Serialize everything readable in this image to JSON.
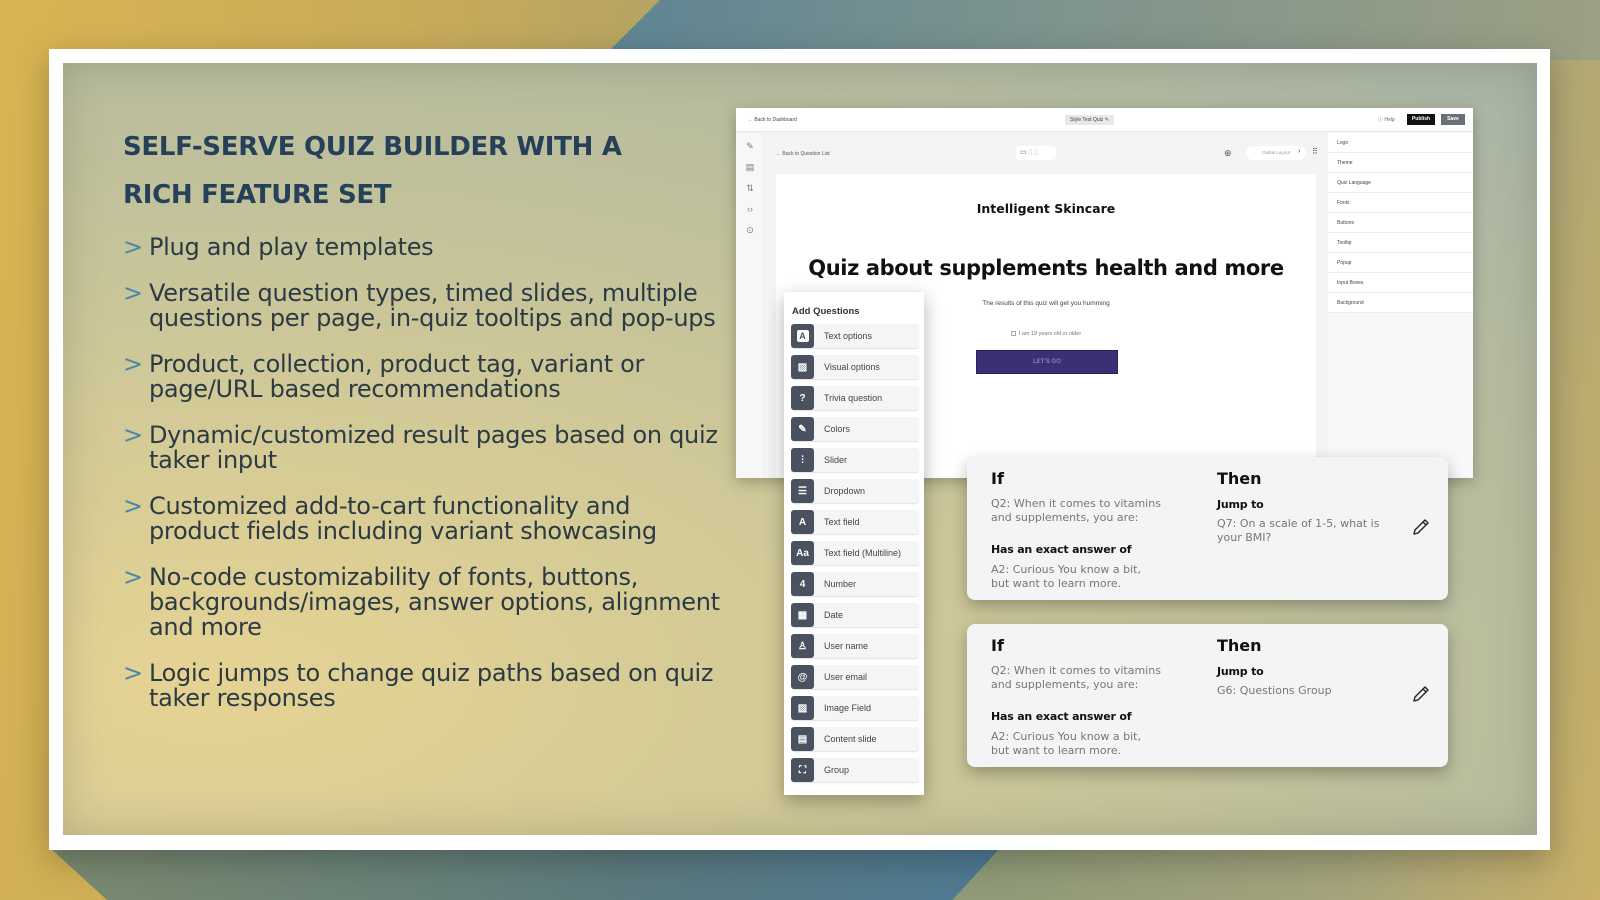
{
  "slide": {
    "headline": "SELF-SERVE QUIZ BUILDER WITH A RICH FEATURE SET",
    "bullet_icon": "chevron-right-icon",
    "features": [
      "Plug and play templates",
      "Versatile question types, timed slides, multiple questions per page, in-quiz tooltips and pop-ups",
      "Product, collection, product tag, variant or page/URL based recommendations",
      "Dynamic/customized result pages based on quiz taker input",
      "Customized add-to-cart functionality and product fields including variant showcasing",
      "No-code customizability of fonts, buttons, backgrounds/images, answer options, alignment and more",
      "Logic jumps to change quiz paths based on quiz taker responses"
    ],
    "colors": {
      "headline": "#27405a",
      "bullet": "#4a86a8",
      "body_text": "#2c3a44"
    }
  },
  "builder": {
    "back_to_dashboard": "← Back to Dashboard",
    "quiz_name": "Style Test Quiz ✎",
    "help": "Help",
    "publish": "Publish",
    "save": "Save",
    "back_to_questions": "← Back to Question List",
    "layout_select": "Global Layout",
    "rail_icons": [
      "edit-icon",
      "layout-icon",
      "logic-icon",
      "code-icon",
      "play-icon"
    ],
    "preview": {
      "brand": "Intelligent Skincare",
      "title": "Quiz about supplements health and more",
      "subtitle": "The results of this quiz will get you humming",
      "age_check": "I am 18 years old or older",
      "cta": "LET'S GO",
      "cta_color": "#3c2f74"
    },
    "style_panel": [
      "Logo",
      "Theme",
      "Quiz Language",
      "Fonts",
      "Buttons",
      "Tooltip",
      "Popup",
      "Input Boxes",
      "Background"
    ]
  },
  "add_questions": {
    "title": "Add Questions",
    "items": [
      {
        "label": "Text options",
        "icon": "text-options-icon",
        "glyph": "A"
      },
      {
        "label": "Visual options",
        "icon": "image-icon",
        "glyph": "▨"
      },
      {
        "label": "Trivia question",
        "icon": "question-icon",
        "glyph": "?"
      },
      {
        "label": "Colors",
        "icon": "paint-brush-icon",
        "glyph": "✎"
      },
      {
        "label": "Slider",
        "icon": "slider-icon",
        "glyph": "⫶"
      },
      {
        "label": "Dropdown",
        "icon": "list-icon",
        "glyph": "☰"
      },
      {
        "label": "Text field",
        "icon": "text-field-icon",
        "glyph": "A"
      },
      {
        "label": "Text field (Multiline)",
        "icon": "multiline-text-icon",
        "glyph": "Aa"
      },
      {
        "label": "Number",
        "icon": "number-icon",
        "glyph": "4"
      },
      {
        "label": "Date",
        "icon": "calendar-icon",
        "glyph": "▦"
      },
      {
        "label": "User name",
        "icon": "user-icon",
        "glyph": "♙"
      },
      {
        "label": "User email",
        "icon": "at-icon",
        "glyph": "@"
      },
      {
        "label": "Image Field",
        "icon": "image-field-icon",
        "glyph": "▨"
      },
      {
        "label": "Content slide",
        "icon": "document-icon",
        "glyph": "▤"
      },
      {
        "label": "Group",
        "icon": "group-icon",
        "glyph": "⛶"
      }
    ]
  },
  "logic_rules": [
    {
      "if_label": "If",
      "question": "Q2: When it comes to vitamins and supplements, you are:",
      "condition": "Has an exact answer of",
      "answer": "A2: Curious You know a bit, but want to learn more.",
      "then_label": "Then",
      "action": "Jump to",
      "target": "Q7: On a scale of 1-5, what is your BMI?"
    },
    {
      "if_label": "If",
      "question": "Q2: When it comes to vitamins and supplements, you are:",
      "condition": "Has an exact answer of",
      "answer": "A2: Curious You know a bit, but want to learn more.",
      "then_label": "Then",
      "action": "Jump to",
      "target": "G6: Questions Group"
    }
  ]
}
